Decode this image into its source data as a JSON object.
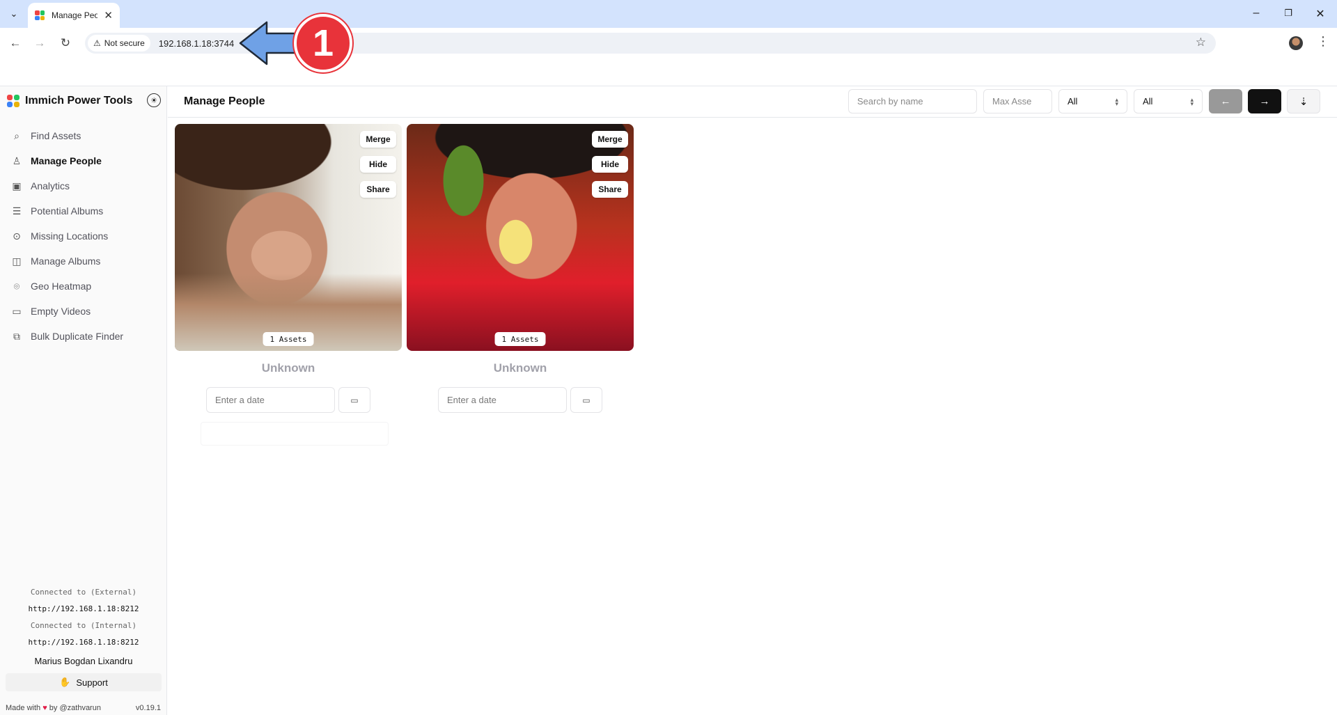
{
  "browser": {
    "tab_title": "Manage Peo",
    "security_label": "Not secure",
    "url": "192.168.1.18:3744",
    "annotation_number": "1"
  },
  "colors": {
    "favicon": [
      "#ef4444",
      "#22c55e",
      "#3b82f6",
      "#eab308"
    ],
    "accent": "#111111",
    "annotation": "#e8333a",
    "arrow": "#6fa1e6"
  },
  "sidebar": {
    "brand": "Immich Power Tools",
    "items": [
      {
        "label": "Find Assets",
        "icon": "search-icon"
      },
      {
        "label": "Manage People",
        "icon": "user-icon"
      },
      {
        "label": "Analytics",
        "icon": "image-icon"
      },
      {
        "label": "Potential Albums",
        "icon": "stack-icon"
      },
      {
        "label": "Missing Locations",
        "icon": "location-search-icon"
      },
      {
        "label": "Manage Albums",
        "icon": "album-icon"
      },
      {
        "label": "Geo Heatmap",
        "icon": "map-pin-icon"
      },
      {
        "label": "Empty Videos",
        "icon": "video-icon"
      },
      {
        "label": "Bulk Duplicate Finder",
        "icon": "copy-icon"
      }
    ],
    "external_label": "Connected to (External)",
    "external_url": "http://192.168.1.18:8212",
    "internal_label": "Connected to (Internal)",
    "internal_url": "http://192.168.1.18:8212",
    "owner": "Marius Bogdan Lixandru",
    "support_label": "Support",
    "made_with_prefix": "Made with",
    "made_with_suffix": "by",
    "author": "@zathvarun",
    "version": "v0.19.1"
  },
  "header": {
    "title": "Manage People",
    "search_placeholder": "Search by name",
    "max_assets_placeholder": "Max Asse",
    "filter1_value": "All",
    "filter2_value": "All"
  },
  "people": [
    {
      "name": "Unknown",
      "assets": "1 Assets",
      "merge": "Merge",
      "hide": "Hide",
      "share": "Share",
      "date_placeholder": "Enter a date"
    },
    {
      "name": "Unknown",
      "assets": "1 Assets",
      "merge": "Merge",
      "hide": "Hide",
      "share": "Share",
      "date_placeholder": "Enter a date"
    }
  ]
}
